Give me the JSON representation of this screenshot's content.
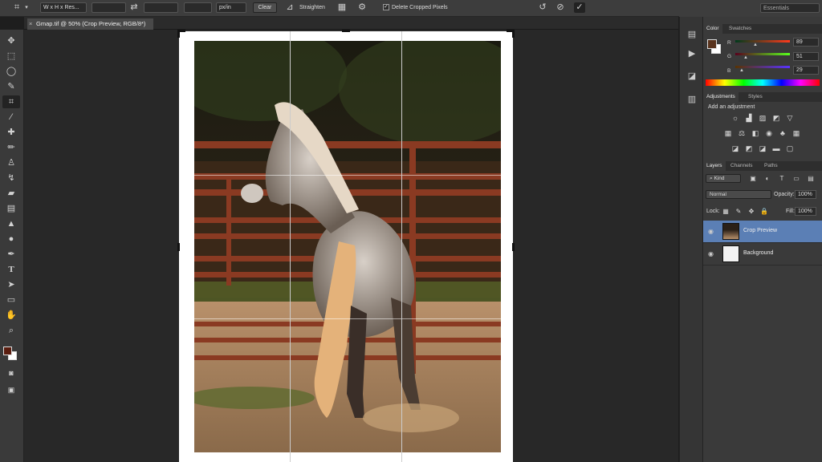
{
  "options_bar": {
    "crop_tool_icon": "crop-icon",
    "ratio_select": "W x H x Res...",
    "width_value": "",
    "height_value": "",
    "resolution_value": "",
    "unit_select": "px/in",
    "clear_label": "Clear",
    "straighten_label": "Straighten",
    "delete_cropped_label": "Delete Cropped Pixels",
    "delete_cropped_checked": "✓",
    "workspace_label": "Essentials"
  },
  "document": {
    "tab_title": "Gmap.tif @ 50% (Crop Preview, RGB/8*)",
    "close_glyph": "×"
  },
  "tools": {
    "foreground_color": "#5a1d0f",
    "background_color": "#ffffff"
  },
  "color_panel": {
    "tabs": [
      "Color",
      "Swatches"
    ],
    "channels": [
      {
        "label": "R",
        "value": "89"
      },
      {
        "label": "G",
        "value": "51"
      },
      {
        "label": "B",
        "value": "29"
      }
    ],
    "current_color": "#59331d"
  },
  "adjustments_panel": {
    "tabs": [
      "Adjustments",
      "Styles"
    ],
    "heading": "Add an adjustment"
  },
  "layers_panel": {
    "tabs": [
      "Layers",
      "Channels",
      "Paths"
    ],
    "filter_label": "Kind",
    "blend_mode": "Normal",
    "opacity_label": "Opacity:",
    "opacity_value": "100%",
    "lock_label": "Lock:",
    "fill_label": "Fill:",
    "fill_value": "100%",
    "layers": [
      {
        "name": "Crop Preview",
        "selected": true
      },
      {
        "name": "Background",
        "selected": false
      }
    ]
  }
}
